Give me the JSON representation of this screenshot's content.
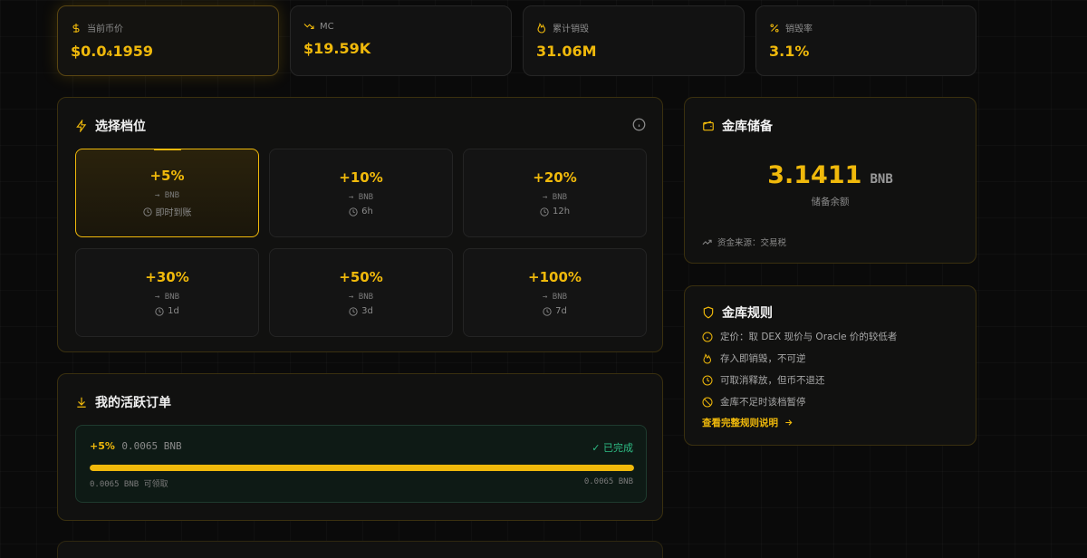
{
  "stats": [
    {
      "icon": "dollar-icon",
      "label": "当前币价",
      "value": "$0.0₄1959"
    },
    {
      "icon": "trending-down-icon",
      "label": "MC",
      "value": "$19.59K"
    },
    {
      "icon": "flame-icon",
      "label": "累计销毁",
      "value": "31.06M"
    },
    {
      "icon": "percent-icon",
      "label": "销毁率",
      "value": "3.1%"
    }
  ],
  "tiers": {
    "title": "选择档位",
    "items": [
      {
        "pct": "+5%",
        "unit": "→ BNB",
        "time": "即时到账",
        "selected": true
      },
      {
        "pct": "+10%",
        "unit": "→ BNB",
        "time": "6h",
        "selected": false
      },
      {
        "pct": "+20%",
        "unit": "→ BNB",
        "time": "12h",
        "selected": false
      },
      {
        "pct": "+30%",
        "unit": "→ BNB",
        "time": "1d",
        "selected": false
      },
      {
        "pct": "+50%",
        "unit": "→ BNB",
        "time": "3d",
        "selected": false
      },
      {
        "pct": "+100%",
        "unit": "→ BNB",
        "time": "7d",
        "selected": false
      }
    ]
  },
  "orders": {
    "title": "我的活跃订单",
    "items": [
      {
        "pct": "+5%",
        "amount": "0.0065 BNB",
        "status": "已完成",
        "progress": 1.0,
        "claimable": "0.0065 BNB 可领取",
        "total": "0.0065 BNB"
      }
    ]
  },
  "vault": {
    "title": "金库储备",
    "amount": "3.1411",
    "unit": "BNB",
    "caption": "储备余额",
    "source": "资金来源：交易税"
  },
  "rules": {
    "title": "金库规则",
    "items": [
      {
        "icon": "info-icon",
        "text": "定价：取 DEX 现价与 Oracle 价的较低者"
      },
      {
        "icon": "flame-icon",
        "text": "存入即销毁，不可逆"
      },
      {
        "icon": "clock-icon",
        "text": "可取消释放，但币不退还"
      },
      {
        "icon": "ban-icon",
        "text": "金库不足时该档暂停"
      }
    ],
    "link": "查看完整规则说明"
  },
  "colors": {
    "accent": "#f0b90b",
    "success": "#2ebd85",
    "background": "#0a0a0a"
  }
}
